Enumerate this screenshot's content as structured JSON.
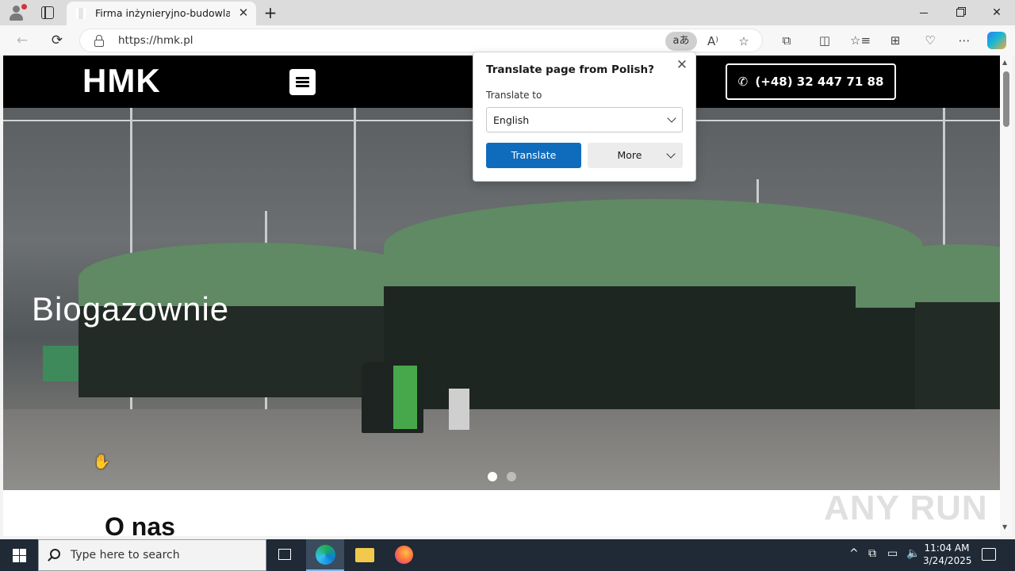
{
  "browser": {
    "tab_title": "Firma inżynieryjno-budowlana | HMK",
    "tab_close_glyph": "✕",
    "new_tab_glyph": "+",
    "url": "https://hmk.pl",
    "translate_pill": "aあ",
    "window_controls": {
      "close_glyph": "✕"
    },
    "toolbar_glyphs": {
      "back": "←",
      "reload": "⟳",
      "read_aloud": "A⁾",
      "favorite": "☆",
      "extensions": "⧉",
      "split": "◫",
      "favorites": "☆≡",
      "collections": "⊞",
      "performance": "♡",
      "menu": "⋯"
    }
  },
  "site": {
    "logo": "HMK",
    "phone": "(+48) 32 447 71 88",
    "phone_icon": "✆",
    "hero_title": "Biogazownie",
    "slider": {
      "count": 2,
      "active_index": 0
    },
    "about_title": "O nas",
    "watermark": "ANY RUN"
  },
  "translate_popup": {
    "title": "Translate page from Polish?",
    "close_glyph": "✕",
    "label": "Translate to",
    "selected_language": "English",
    "translate_button": "Translate",
    "more_button": "More"
  },
  "taskbar": {
    "search_placeholder": "Type here to search",
    "time": "11:04 AM",
    "date": "3/24/2025",
    "tray_glyphs": {
      "chevron": "^",
      "meet": "⧉",
      "network": "▭",
      "volume": "🔈"
    }
  },
  "scrollbar": {
    "up_glyph": "▲",
    "down_glyph": "▼"
  },
  "colors": {
    "accent": "#0f6cbd",
    "header_bg": "#000000",
    "taskbar_bg": "#1f2a36",
    "dome_green": "#5f8a63"
  }
}
